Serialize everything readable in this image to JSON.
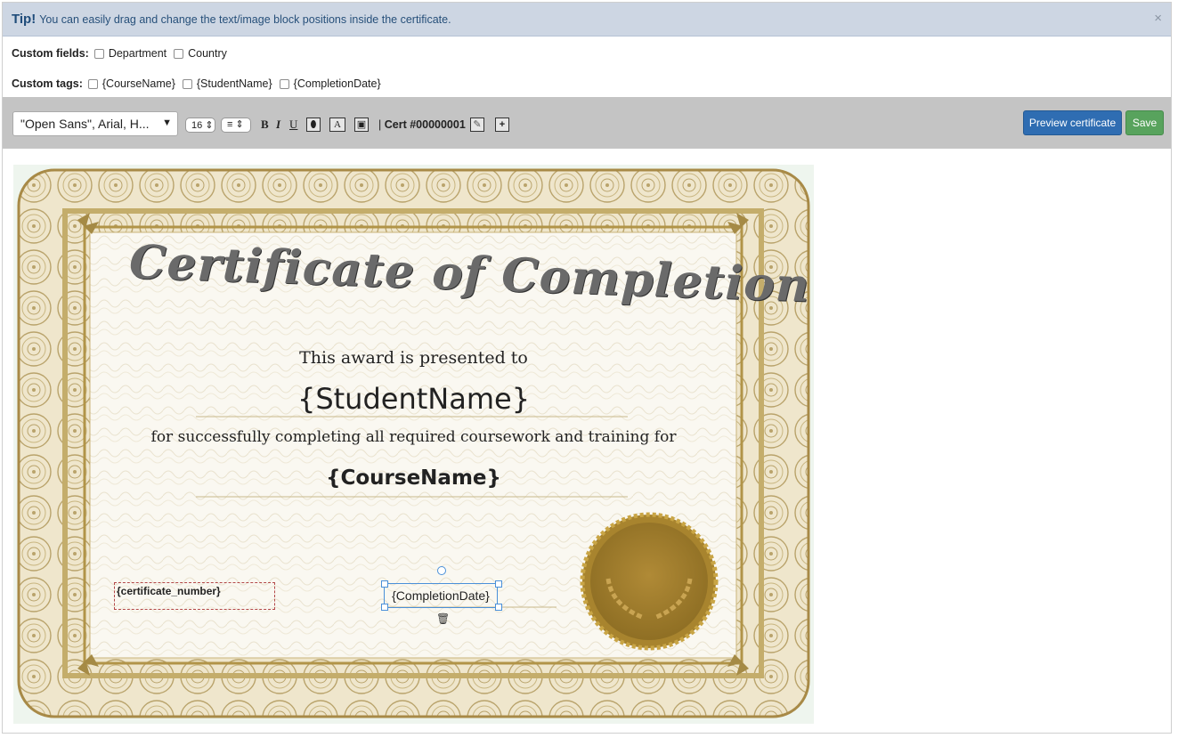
{
  "tip": {
    "label": "Tip!",
    "text": "You can easily drag and change the text/image block positions inside the certificate.",
    "close": "×"
  },
  "custom_fields": {
    "label": "Custom fields:",
    "options": [
      "Department",
      "Country"
    ]
  },
  "custom_tags": {
    "label": "Custom tags:",
    "options": [
      "{CourseName}",
      "{StudentName}",
      "{CompletionDate}"
    ]
  },
  "toolbar": {
    "font": "\"Open Sans\", Arial, H...",
    "font_caret": "▼",
    "size": "16",
    "align_icon": "≡",
    "bold": "B",
    "italic": "I",
    "underline": "U",
    "color_icon": "⬮",
    "bg_icon": "A",
    "image_icon": "▣",
    "separator": "|",
    "cert_label": "Cert #00000001",
    "edit_icon": "✎",
    "add_icon": "+",
    "preview_label": "Preview certificate",
    "save_label": "Save"
  },
  "certificate": {
    "title": "Certificate of Completion",
    "presented": "This award is presented to",
    "student": "{StudentName}",
    "success": "for successfully completing all required coursework and training for",
    "course": "{CourseName}",
    "cert_number": "{certificate_number}",
    "completion_date": "{CompletionDate}",
    "trash_icon": "🗑"
  },
  "colors": {
    "accent": "#2f6db2",
    "save": "#58a35d",
    "gold": "#a88530",
    "tip_bg": "#cdd6e3"
  }
}
